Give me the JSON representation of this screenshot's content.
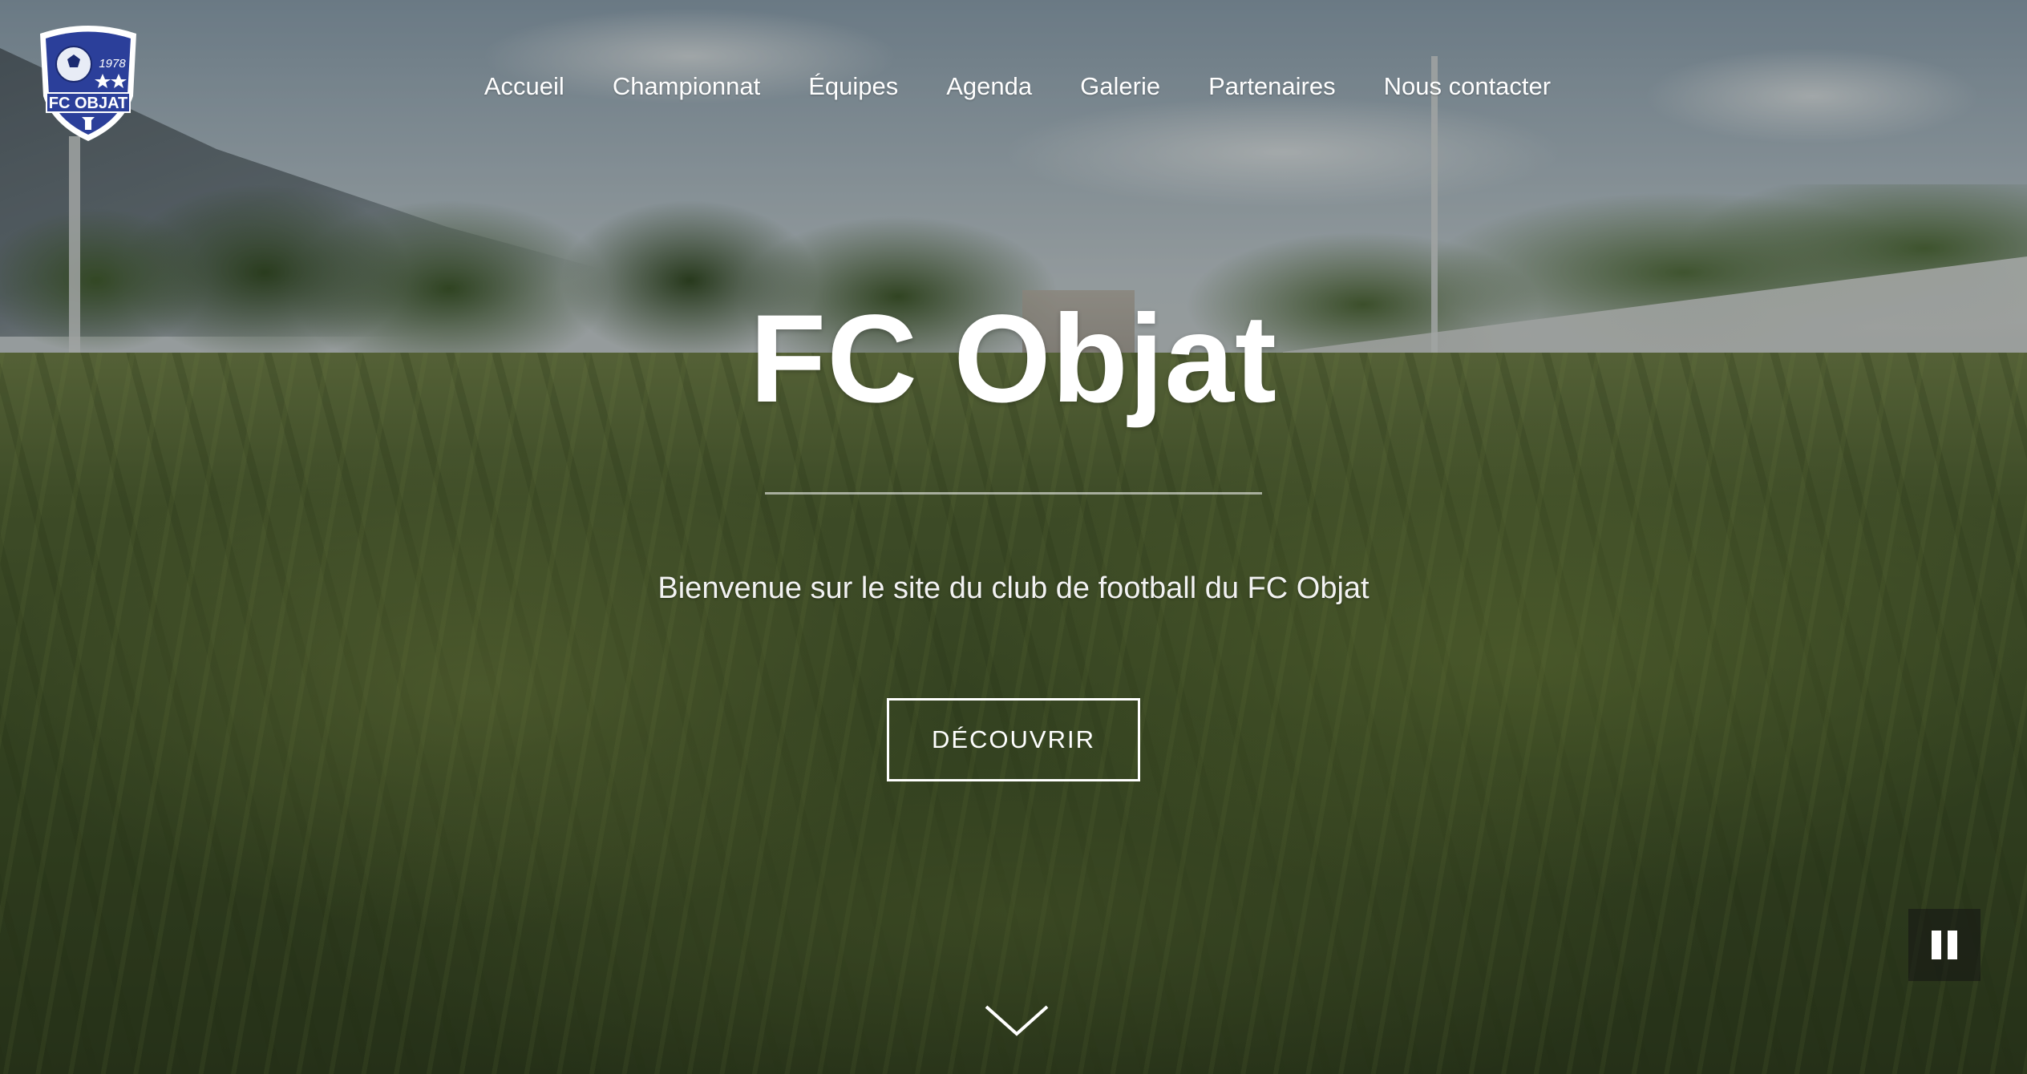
{
  "logo": {
    "text": "FC OBJAT",
    "year": "1978",
    "colors": {
      "primary": "#2b3f9a",
      "border": "#ffffff"
    }
  },
  "nav": {
    "items": [
      {
        "label": "Accueil"
      },
      {
        "label": "Championnat"
      },
      {
        "label": "Équipes"
      },
      {
        "label": "Agenda"
      },
      {
        "label": "Galerie"
      },
      {
        "label": "Partenaires"
      },
      {
        "label": "Nous contacter"
      }
    ]
  },
  "hero": {
    "title": "FC Objat",
    "subtitle": "Bienvenue sur le site du club de football du FC Objat",
    "cta_label": "DÉCOUVRIR"
  },
  "icons": {
    "scroll": "chevron-down-icon",
    "video_control": "pause-icon"
  },
  "colors": {
    "text": "#ffffff",
    "overlay": "rgba(20,24,18,0.28)"
  }
}
